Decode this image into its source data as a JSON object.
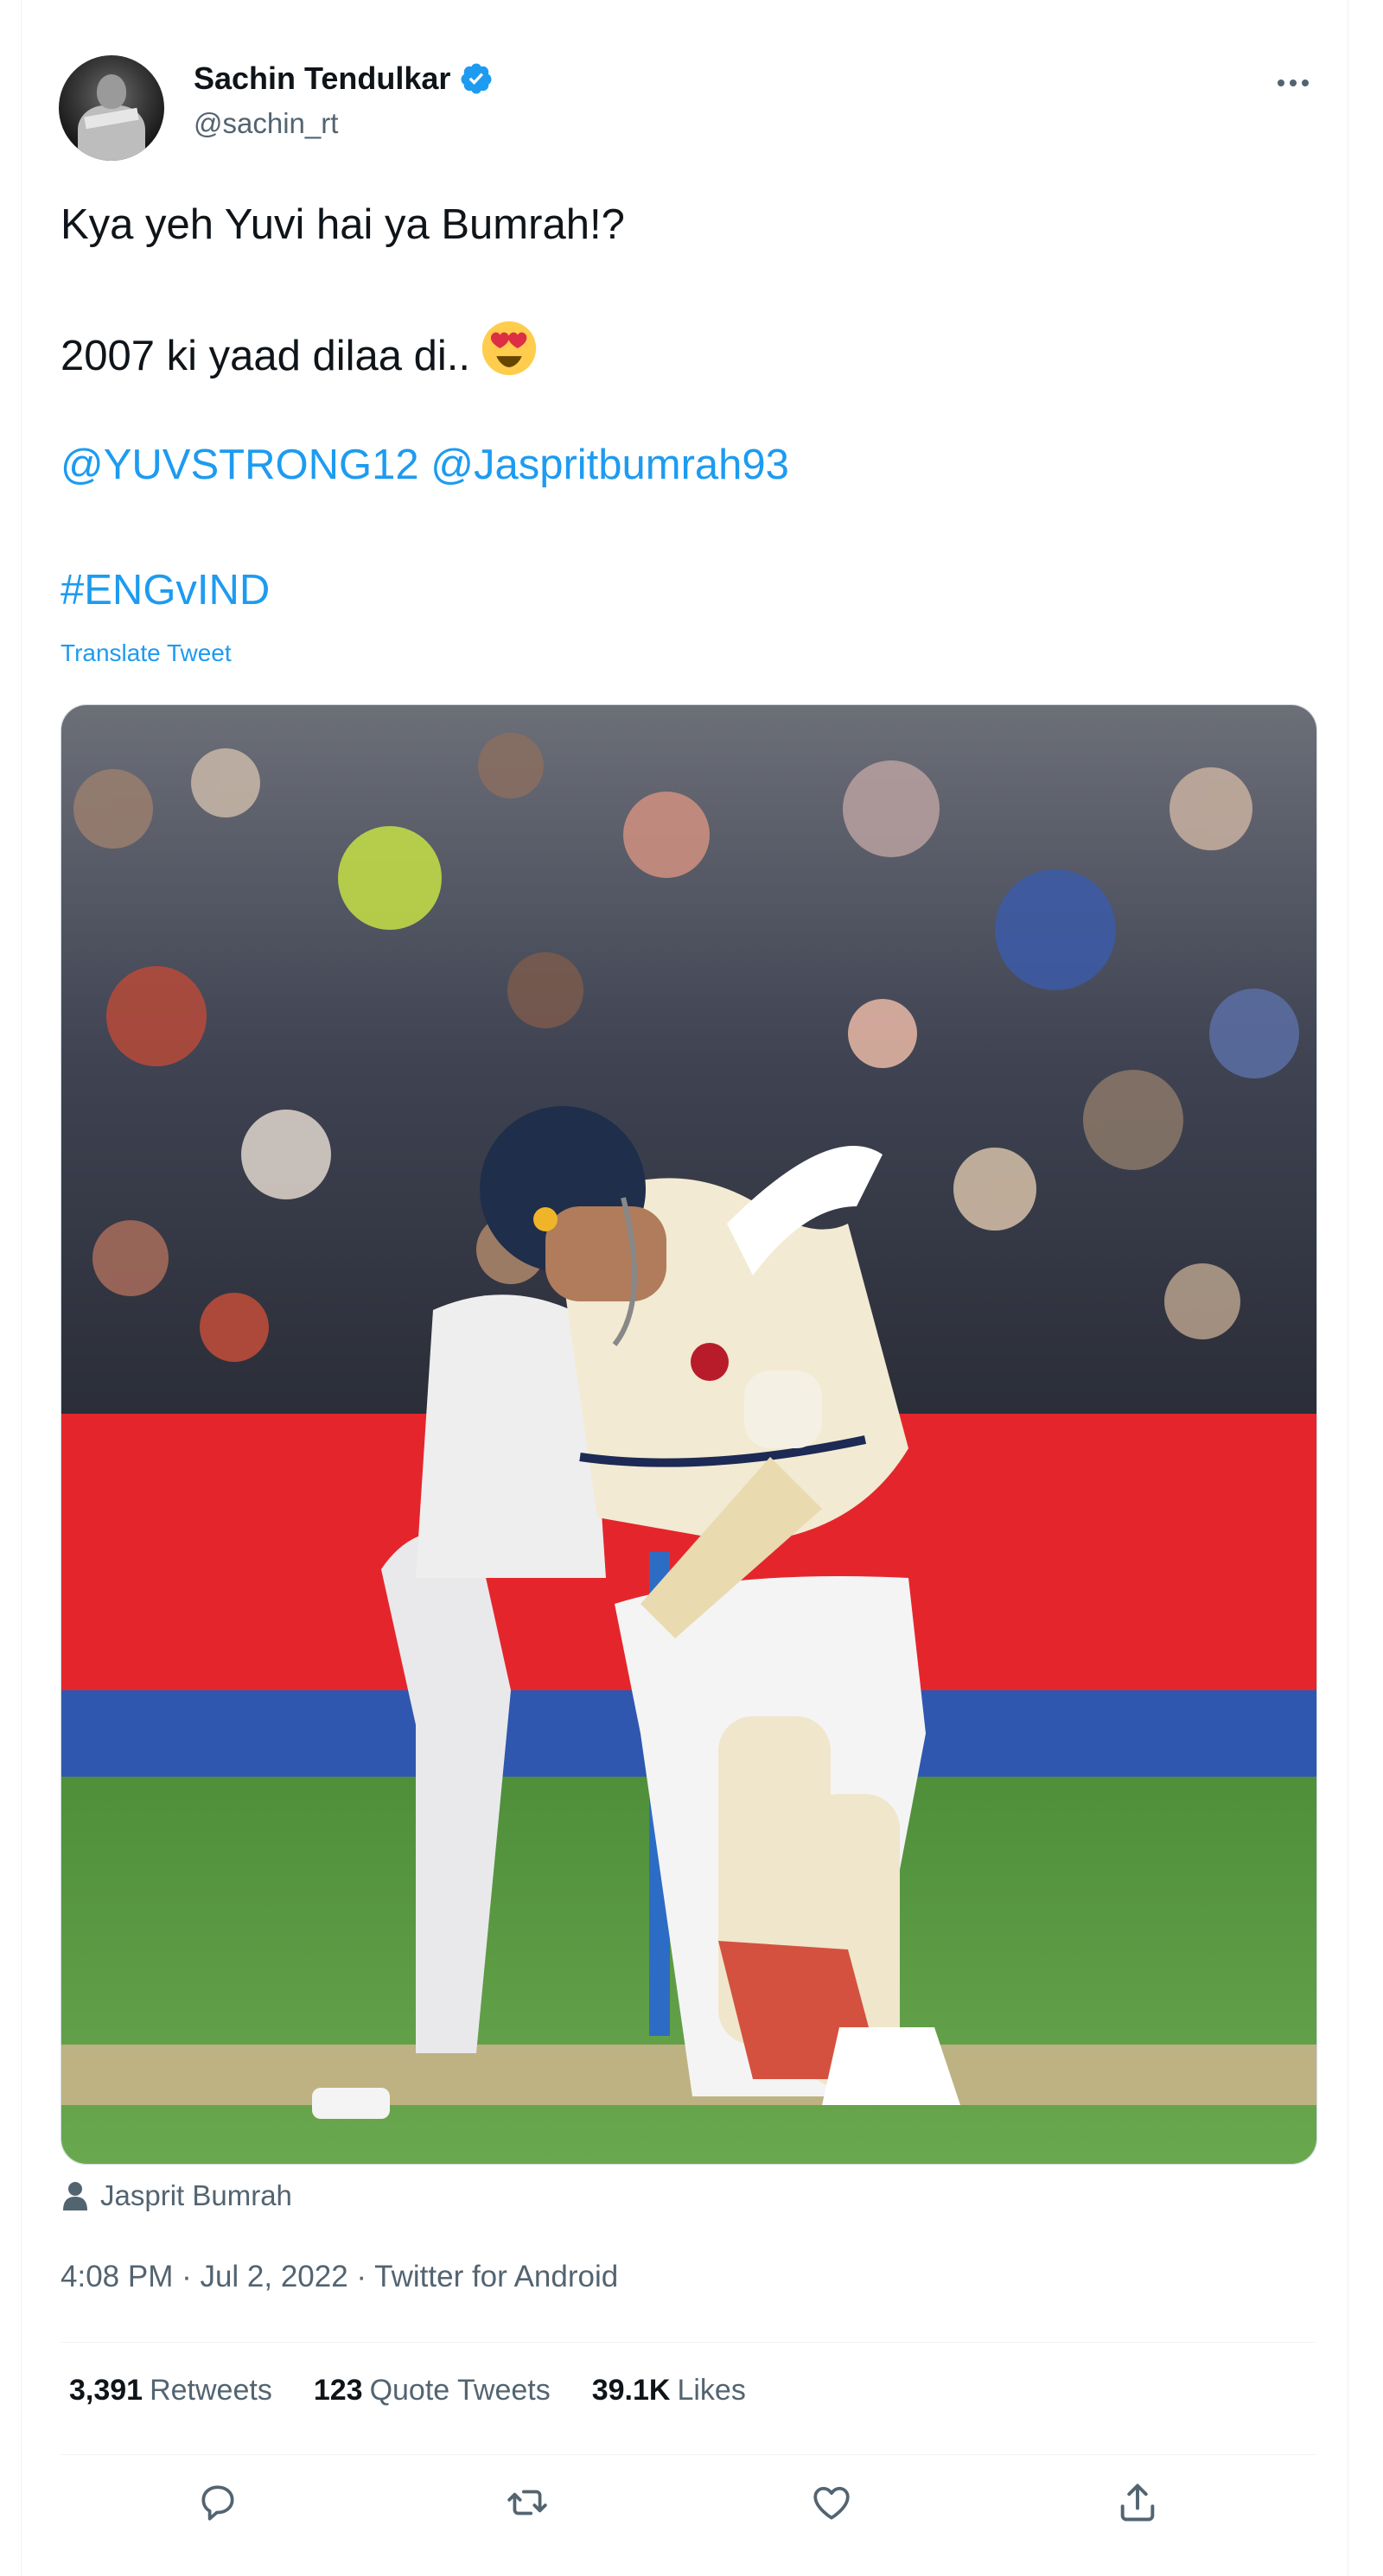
{
  "tweet": {
    "author_name": "Sachin Tendulkar",
    "handle": "@sachin_rt",
    "line1": "Kya yeh Yuvi hai ya Bumrah!?",
    "line2": "2007 ki yaad dilaa di..",
    "mentions": "@YUVSTRONG12 @Jaspritbumrah93",
    "hashtag": "#ENGvIND",
    "translate_label": "Translate Tweet",
    "tagged_person": "Jasprit Bumrah",
    "timestamp": "4:08 PM · Jul 2, 2022 · Twitter for Android"
  },
  "stats": {
    "retweets_count": "3,391",
    "retweets_label": "Retweets",
    "quotes_count": "123",
    "quotes_label": "Quote Tweets",
    "likes_count": "39.1K",
    "likes_label": "Likes"
  },
  "icons": {
    "verified": "verified-badge-icon",
    "more": "more-icon",
    "emoji": "smiling-face-with-heart-eyes",
    "tag": "person-icon",
    "reply": "reply-icon",
    "retweet": "retweet-icon",
    "like": "heart-icon",
    "share": "share-icon"
  },
  "colors": {
    "link": "#1d9bf0",
    "secondary_text": "#536471",
    "primary_text": "#0f1419"
  }
}
